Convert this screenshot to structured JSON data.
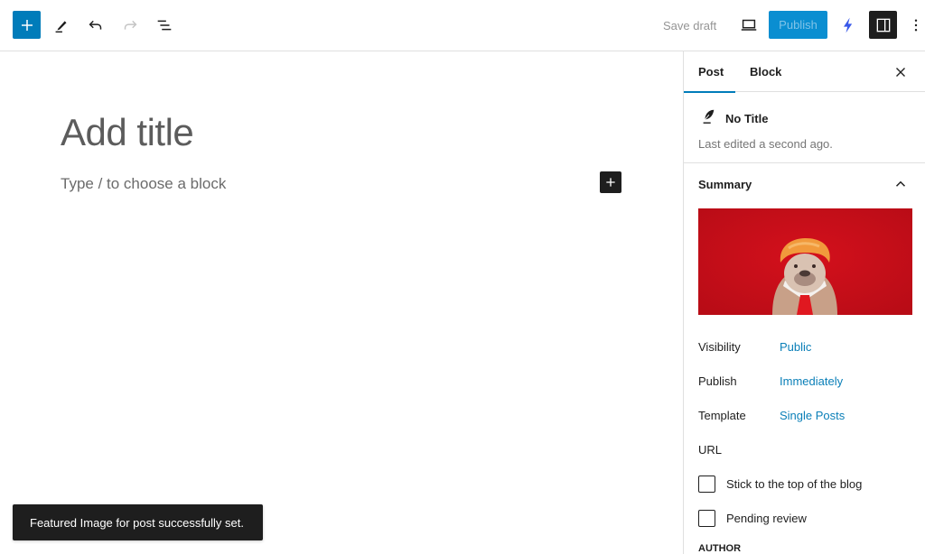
{
  "toolbar": {
    "inserter_icon": "plus-icon",
    "tools_icon": "pencil-icon",
    "undo_icon": "undo-icon",
    "redo_icon": "redo-icon",
    "list_view_icon": "list-view-icon",
    "save_draft_label": "Save draft",
    "preview_icon": "laptop-icon",
    "publish_label": "Publish",
    "performance_icon": "bolt-icon",
    "settings_icon": "sidebar-toggle-icon",
    "more_icon": "more-vertical-icon",
    "colors": {
      "accent": "#007cba",
      "bolt": "#3858e9",
      "dark": "#1e1e1e"
    }
  },
  "editor": {
    "title_placeholder": "Add title",
    "block_placeholder": "Type / to choose a block",
    "snackbar_message": "Featured Image for post successfully set."
  },
  "sidebar": {
    "tabs": [
      {
        "label": "Post",
        "active": true
      },
      {
        "label": "Block",
        "active": false
      }
    ],
    "post_card": {
      "title": "No Title",
      "last_edited": "Last edited a second ago."
    },
    "summary": {
      "heading": "Summary",
      "featured_image_alt": "Bulldog wearing orange wig and red tie on red background",
      "rows": [
        {
          "label": "Visibility",
          "value": "Public"
        },
        {
          "label": "Publish",
          "value": "Immediately"
        },
        {
          "label": "Template",
          "value": "Single Posts"
        },
        {
          "label": "URL",
          "value": ""
        }
      ],
      "checkboxes": [
        {
          "label": "Stick to the top of the blog",
          "checked": false
        },
        {
          "label": "Pending review",
          "checked": false
        }
      ],
      "author_heading": "AUTHOR"
    }
  }
}
